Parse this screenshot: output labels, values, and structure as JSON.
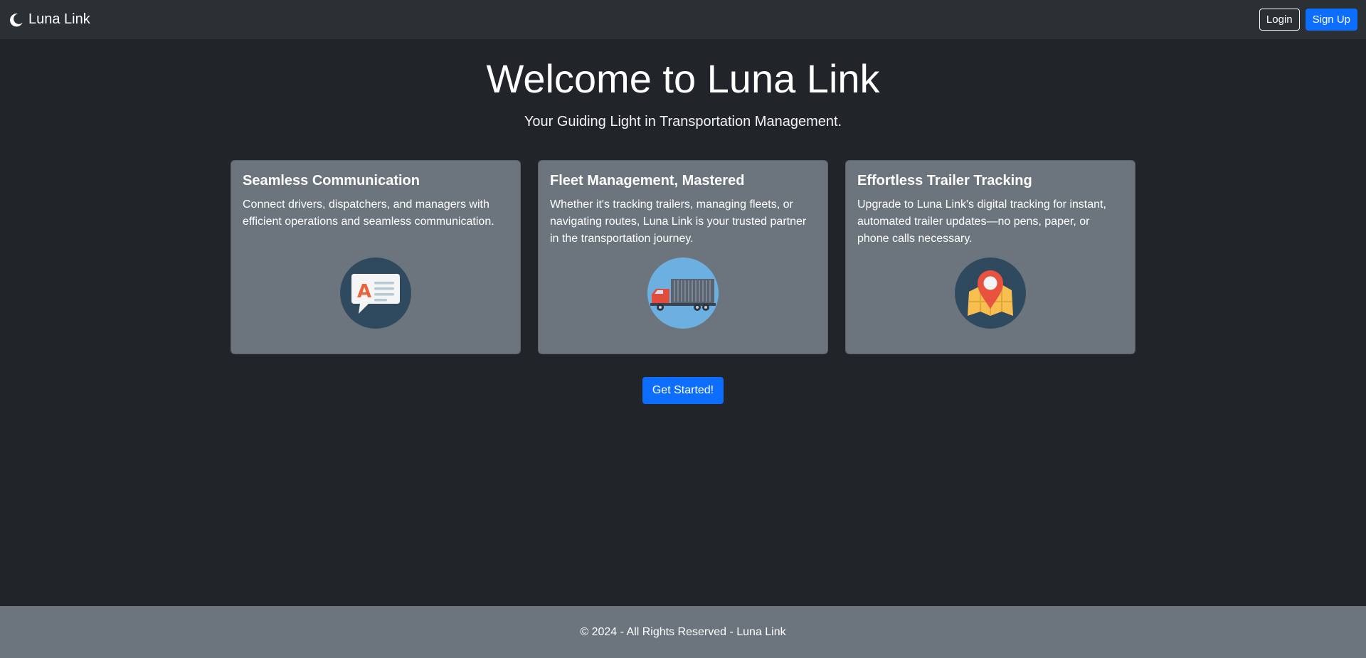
{
  "navbar": {
    "brand_icon": "crescent-moon-icon",
    "brand_name": "Luna Link",
    "login_label": "Login",
    "signup_label": "Sign Up"
  },
  "hero": {
    "title": "Welcome to Luna Link",
    "subtitle": "Your Guiding Light in Transportation Management."
  },
  "cards": [
    {
      "title": "Seamless Communication",
      "text": "Connect drivers, dispatchers, and managers with efficient operations and seamless communication.",
      "icon": "chat-bubble-icon"
    },
    {
      "title": "Fleet Management, Mastered",
      "text": "Whether it's tracking trailers, managing fleets, or navigating routes, Luna Link is your trusted partner in the transportation journey.",
      "icon": "truck-icon"
    },
    {
      "title": "Effortless Trailer Tracking",
      "text": "Upgrade to Luna Link's digital tracking for instant, automated trailer updates—no pens, paper, or phone calls necessary.",
      "icon": "map-pin-icon"
    }
  ],
  "cta": {
    "label": "Get Started!"
  },
  "footer": {
    "text": "© 2024 - All Rights Reserved - Luna Link"
  },
  "colors": {
    "background": "#212529",
    "navbar": "#2b3035",
    "card": "#6c757d",
    "primary": "#0d6efd",
    "footer": "#6c757d"
  }
}
